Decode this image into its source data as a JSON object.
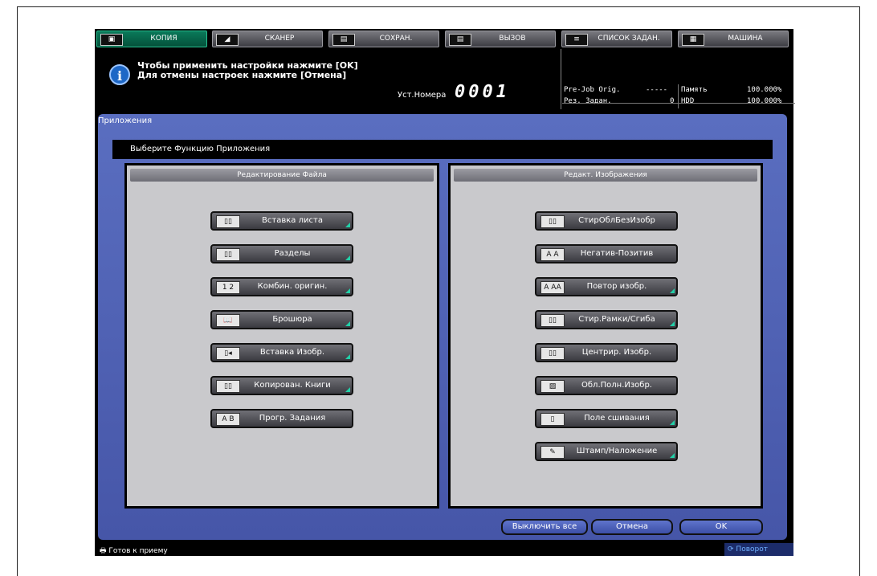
{
  "tabs": [
    {
      "label": "КОПИЯ",
      "icon": "copy-icon",
      "glyph": "▣"
    },
    {
      "label": "СКАНЕР",
      "icon": "scanner-icon",
      "glyph": "◢"
    },
    {
      "label": "СОХРАН.",
      "icon": "store-icon",
      "glyph": "▤"
    },
    {
      "label": "ВЫЗОВ",
      "icon": "recall-icon",
      "glyph": "▤"
    },
    {
      "label": "СПИСОК ЗАДАН.",
      "icon": "job-list-icon",
      "glyph": "≡"
    },
    {
      "label": "МАШИНА",
      "icon": "machine-icon",
      "glyph": "▦"
    }
  ],
  "header": {
    "message_line1": "Чтобы применить настройки нажмите [OK]",
    "message_line2": "Для отмены настроек нажмите [Отмена]",
    "set_number_label": "Уст.Номера",
    "set_number_value": "0001",
    "prejob_label": "Pre-Job Orig.",
    "prejob_value": "-----",
    "reserved_label": "Рез. Задан.",
    "reserved_value": "0",
    "memory_label": "Память",
    "memory_value": "100.000%",
    "hdd_label": "HDD",
    "hdd_value": "100.000%"
  },
  "app": {
    "title": "Приложения",
    "subtitle": "Выберите Функцию Приложения"
  },
  "left_panel": {
    "title": "Редактирование Файла",
    "buttons": [
      {
        "label": "Вставка листа",
        "icon": "insert-sheet-icon",
        "glyph": "▯▯"
      },
      {
        "label": "Разделы",
        "icon": "chapters-icon",
        "glyph": "▯▯"
      },
      {
        "label": "Комбин. оригин.",
        "icon": "combine-originals-icon",
        "glyph": "1 2"
      },
      {
        "label": "Брошюра",
        "icon": "booklet-icon",
        "glyph": "📖"
      },
      {
        "label": "Вставка Изобр.",
        "icon": "insert-image-icon",
        "glyph": "▯◂"
      },
      {
        "label": "Копирован. Книги",
        "icon": "book-copy-icon",
        "glyph": "▯▯"
      },
      {
        "label": "Прогр. Задания",
        "icon": "program-job-icon",
        "glyph": "A B"
      }
    ]
  },
  "right_panel": {
    "title": "Редакт. Изображения",
    "buttons": [
      {
        "label": "СтирОблБезИзобр",
        "icon": "non-image-erase-icon",
        "glyph": "▯▯"
      },
      {
        "label": "Негатив-Позитив",
        "icon": "neg-pos-icon",
        "glyph": "A A"
      },
      {
        "label": "Повтор изобр.",
        "icon": "image-repeat-icon",
        "glyph": "A AA"
      },
      {
        "label": "Стир.Рамки/Сгиба",
        "icon": "frame-fold-erase-icon",
        "glyph": "▯▯"
      },
      {
        "label": "Центрир. Изобр.",
        "icon": "image-centering-icon",
        "glyph": "▯▯"
      },
      {
        "label": "Обл.Полн.Изобр.",
        "icon": "full-image-area-icon",
        "glyph": "▨"
      },
      {
        "label": "Поле сшивания",
        "icon": "binding-margin-icon",
        "glyph": "▯"
      },
      {
        "label": "Штамп/Наложение",
        "icon": "stamp-overlay-icon",
        "glyph": "✎"
      }
    ]
  },
  "bottom": {
    "disable_all": "Выключить все",
    "cancel": "Отмена",
    "ok": "OK"
  },
  "status": {
    "ready": "Готов к приему",
    "rotate": "Поворот"
  }
}
